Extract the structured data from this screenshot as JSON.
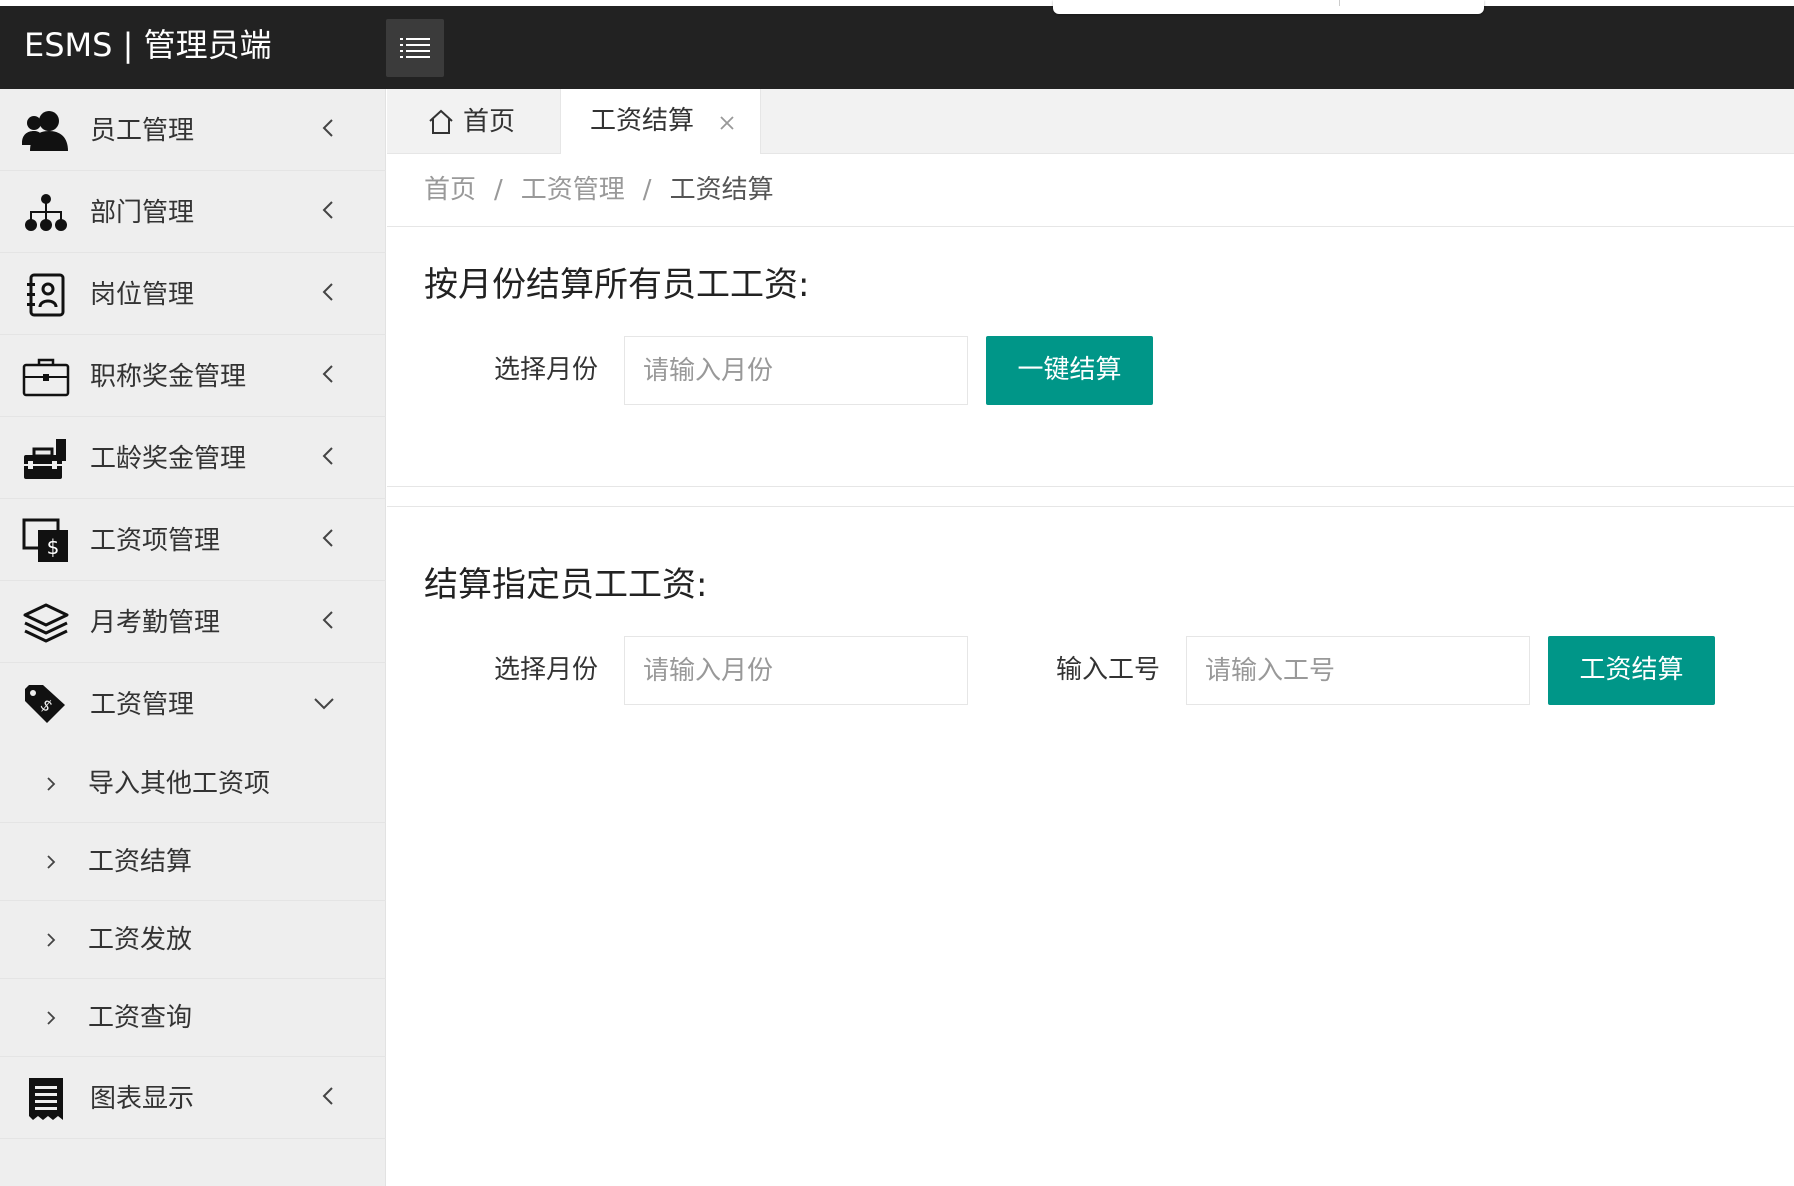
{
  "header": {
    "title": "ESMS | 管理员端",
    "menu_toggle_icon": "list-icon"
  },
  "sidebar": {
    "items": [
      {
        "label": "员工管理",
        "icon": "users-icon"
      },
      {
        "label": "部门管理",
        "icon": "sitemap-icon"
      },
      {
        "label": "岗位管理",
        "icon": "contact-book-icon"
      },
      {
        "label": "职称奖金管理",
        "icon": "briefcase-icon"
      },
      {
        "label": "工龄奖金管理",
        "icon": "toolbox-icon"
      },
      {
        "label": "工资项管理",
        "icon": "money-screen-icon"
      },
      {
        "label": "月考勤管理",
        "icon": "layers-icon"
      },
      {
        "label": "工资管理",
        "icon": "price-tag-icon"
      },
      {
        "label": "图表显示",
        "icon": "receipt-icon"
      }
    ],
    "sub_items": [
      {
        "label": "导入其他工资项"
      },
      {
        "label": "工资结算"
      },
      {
        "label": "工资发放"
      },
      {
        "label": "工资查询"
      }
    ]
  },
  "tabs": {
    "home": "首页",
    "active": "工资结算"
  },
  "breadcrumb": {
    "home": "首页",
    "sep": "/",
    "parent": "工资管理",
    "current": "工资结算"
  },
  "section1": {
    "title": "按月份结算所有员工工资:",
    "month_label": "选择月份",
    "month_placeholder": "请输入月份",
    "button": "一键结算"
  },
  "section2": {
    "title": "结算指定员工工资:",
    "month_label": "选择月份",
    "month_placeholder": "请输入月份",
    "id_label": "输入工号",
    "id_placeholder": "请输入工号",
    "button": "工资结算"
  },
  "colors": {
    "header_bg": "#222222",
    "sidebar_bg": "#eeeeee",
    "accent": "#009688"
  }
}
